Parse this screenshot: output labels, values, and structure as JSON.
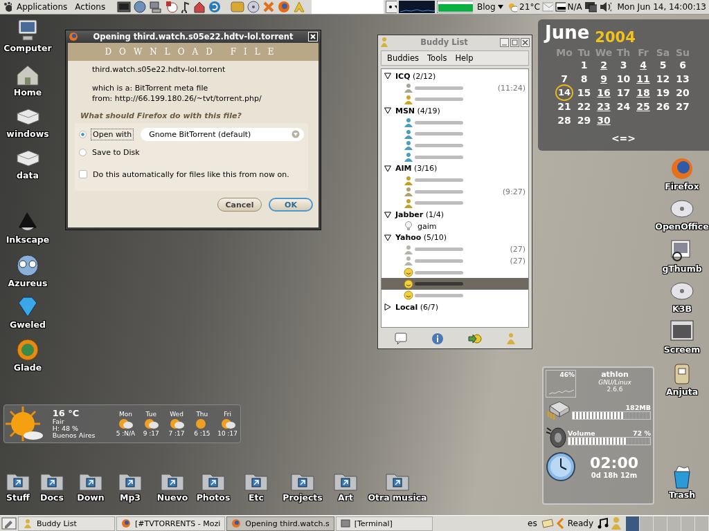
{
  "top_panel": {
    "menus": [
      {
        "label": "Applications"
      },
      {
        "label": "Actions"
      }
    ],
    "blog_button": "Blog",
    "weather": "21°C",
    "mail_status": "N/A",
    "clock": "Mon Jun 14, 14:00:13"
  },
  "desktop_icons_left": [
    "Computer",
    "Home",
    "windows",
    "data",
    "Inkscape",
    "Azureus",
    "Gweled",
    "Glade"
  ],
  "desktop_icons_right": [
    "Firefox",
    "OpenOffice",
    "gThumb",
    "K3B",
    "Screem",
    "Anjuta",
    "Trash"
  ],
  "folders": [
    "Stuff",
    "Docs",
    "Down",
    "Mp3",
    "Nuevo",
    "Photos",
    "Etc",
    "Projects",
    "Art",
    "Otra musica"
  ],
  "download_dialog": {
    "title": "Opening third.watch.s05e22.hdtv-lol.torrent",
    "header": "DOWNLOAD FILE",
    "filename": "third.watch.s05e22.hdtv-lol.torrent",
    "type_line": "which is a: BitTorrent meta file",
    "from_line": "from: http://66.199.180.26/~tvt/torrent.php/",
    "question": "What should Firefox do with this file?",
    "options": [
      {
        "label": "Open with",
        "selected": true
      },
      {
        "label": "Save to Disk",
        "selected": false
      }
    ],
    "app_choice": "Gnome BitTorrent (default)",
    "auto_checkbox": {
      "label": "Do this automatically for files like this from now on.",
      "checked": false
    },
    "buttons": [
      {
        "label": "Cancel",
        "default": false
      },
      {
        "label": "OK",
        "default": true
      }
    ]
  },
  "buddy_list": {
    "title": "Buddy List",
    "menus": [
      "Buddies",
      "Tools",
      "Help"
    ],
    "groups": [
      {
        "name": "ICQ",
        "count": "(2/12)",
        "expanded": true,
        "buddies": [
          {
            "kind": "icq-away",
            "idle": "(11:24)",
            "selected": false
          },
          {
            "kind": "icq-online",
            "selected": false
          }
        ]
      },
      {
        "name": "MSN",
        "count": "(4/19)",
        "expanded": true,
        "buddies": [
          {
            "kind": "msn-away",
            "selected": false
          },
          {
            "kind": "msn-online",
            "selected": false
          },
          {
            "kind": "msn-online",
            "selected": false
          },
          {
            "kind": "msn-online",
            "selected": false
          }
        ]
      },
      {
        "name": "AIM",
        "count": "(3/16)",
        "expanded": true,
        "buddies": [
          {
            "kind": "aim-mobile",
            "selected": false
          },
          {
            "kind": "aim-idle",
            "idle": "(9:27)",
            "selected": false
          },
          {
            "kind": "aim-mobile",
            "selected": false
          }
        ]
      },
      {
        "name": "Jabber",
        "count": "(1/4)",
        "expanded": true,
        "buddies": [
          {
            "kind": "jabber",
            "name": "gaim",
            "selected": false
          }
        ]
      },
      {
        "name": "Yahoo",
        "count": "(5/10)",
        "expanded": true,
        "buddies": [
          {
            "kind": "yahoo-away",
            "idle": "(27)",
            "selected": false
          },
          {
            "kind": "yahoo-away",
            "idle": "(27)",
            "selected": false
          },
          {
            "kind": "yahoo-online",
            "selected": false
          },
          {
            "kind": "yahoo-online",
            "selected": true
          },
          {
            "kind": "yahoo-online",
            "selected": false
          }
        ]
      },
      {
        "name": "Local",
        "count": "(6/7)",
        "expanded": false
      }
    ]
  },
  "calendar": {
    "month": "June",
    "year": "2004",
    "weekdays": [
      "Mo",
      "Tu",
      "We",
      "Th",
      "Fr",
      "Sa",
      "Su"
    ],
    "weeks": [
      [
        {
          "kind": "blank"
        },
        {
          "kind": "day",
          "day": "1",
          "marked": false,
          "today": false
        },
        {
          "kind": "day",
          "day": "2",
          "marked": true,
          "today": false
        },
        {
          "kind": "day",
          "day": "3",
          "marked": false,
          "today": false
        },
        {
          "kind": "day",
          "day": "4",
          "marked": true,
          "today": false
        },
        {
          "kind": "day",
          "day": "5",
          "marked": false,
          "today": false
        },
        {
          "kind": "day",
          "day": "6",
          "marked": false,
          "today": false
        }
      ],
      [
        {
          "kind": "day",
          "day": "7",
          "marked": false,
          "today": false
        },
        {
          "kind": "day",
          "day": "8",
          "marked": false,
          "today": false
        },
        {
          "kind": "day",
          "day": "9",
          "marked": true,
          "today": false
        },
        {
          "kind": "day",
          "day": "10",
          "marked": false,
          "today": false
        },
        {
          "kind": "day",
          "day": "11",
          "marked": true,
          "today": false
        },
        {
          "kind": "day",
          "day": "12",
          "marked": false,
          "today": false
        },
        {
          "kind": "day",
          "day": "13",
          "marked": false,
          "today": false
        }
      ],
      [
        {
          "kind": "day",
          "day": "14",
          "marked": false,
          "today": true
        },
        {
          "kind": "day",
          "day": "15",
          "marked": false,
          "today": false
        },
        {
          "kind": "day",
          "day": "16",
          "marked": true,
          "today": false
        },
        {
          "kind": "day",
          "day": "17",
          "marked": false,
          "today": false
        },
        {
          "kind": "day",
          "day": "18",
          "marked": true,
          "today": false
        },
        {
          "kind": "day",
          "day": "19",
          "marked": false,
          "today": false
        },
        {
          "kind": "day",
          "day": "20",
          "marked": false,
          "today": false
        }
      ],
      [
        {
          "kind": "day",
          "day": "21",
          "marked": false,
          "today": false
        },
        {
          "kind": "day",
          "day": "22",
          "marked": false,
          "today": false
        },
        {
          "kind": "day",
          "day": "23",
          "marked": true,
          "today": false
        },
        {
          "kind": "day",
          "day": "24",
          "marked": false,
          "today": false
        },
        {
          "kind": "day",
          "day": "25",
          "marked": true,
          "today": false
        },
        {
          "kind": "day",
          "day": "26",
          "marked": false,
          "today": false
        },
        {
          "kind": "day",
          "day": "27",
          "marked": false,
          "today": false
        }
      ],
      [
        {
          "kind": "day",
          "day": "28",
          "marked": false,
          "today": false
        },
        {
          "kind": "day",
          "day": "29",
          "marked": false,
          "today": false
        },
        {
          "kind": "day",
          "day": "30",
          "marked": true,
          "today": false
        }
      ]
    ],
    "nav": "<=>"
  },
  "weather_widget": {
    "temperature": "16 °C",
    "condition": "Fair",
    "humidity": "H: 48 %",
    "city": "Buenos Aires",
    "forecast": [
      {
        "day": "Mon",
        "temps": "5 :N/A",
        "kind": "partly-cloudy"
      },
      {
        "day": "Tue",
        "temps": "9 :17",
        "kind": "partly-cloudy"
      },
      {
        "day": "Wed",
        "temps": "7 :17",
        "kind": "partly-cloudy"
      },
      {
        "day": "Thu",
        "temps": "6 :15",
        "kind": "sunny"
      },
      {
        "day": "Fri",
        "temps": "10 :17",
        "kind": "partly-cloudy"
      }
    ]
  },
  "system_monitor": {
    "cpu": "46%",
    "host": "athlon",
    "os": "GNU/Linux",
    "kernel": "2.6.6",
    "memory": {
      "reading": "182MB",
      "level": 0.67
    },
    "volume": {
      "label": "Volume",
      "reading": "72 %",
      "level": 0.72
    },
    "time": "02:00",
    "uptime": "0d 18h 12m"
  },
  "taskbar": {
    "tasks": [
      {
        "label": "Buddy List",
        "kind": "buddy",
        "selected": false
      },
      {
        "label": "[#TVTORRENTS - Mozi",
        "kind": "browser",
        "selected": false
      },
      {
        "label": "Opening third.watch.s",
        "kind": "browser",
        "selected": true
      },
      {
        "label": "[Terminal]",
        "kind": "terminal",
        "selected": false
      }
    ],
    "keyboard": "es",
    "status": "Ready",
    "workspaces": [
      {
        "selected": true
      },
      {
        "selected": false
      },
      {
        "selected": false
      },
      {
        "selected": false
      },
      {
        "selected": false
      },
      {
        "selected": false
      }
    ]
  }
}
